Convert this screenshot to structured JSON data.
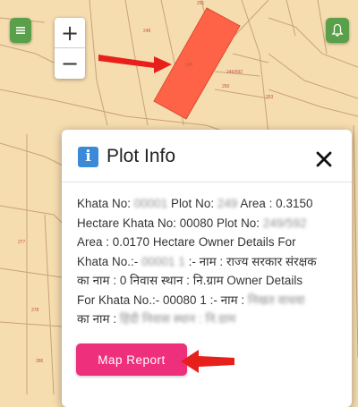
{
  "map": {
    "parcel_labels": [
      "248",
      "249",
      "249/592",
      "250",
      "251",
      "253",
      "277",
      "278",
      "286"
    ],
    "highlight_color": "#ff6347",
    "annotation_color": "#e8201c"
  },
  "controls": {
    "menu_icon": "menu-icon",
    "zoom_in": "+",
    "zoom_out": "−",
    "bell_icon": "bell-icon"
  },
  "panel": {
    "title": "Plot Info",
    "icon": "info-icon",
    "close": "close-icon",
    "lines": [
      [
        "Khata No: ",
        {
          "blur": "00001"
        },
        " Plot No: ",
        {
          "blur": "249"
        },
        " Area : 0.3150"
      ],
      [
        "Hectare Khata No: 00080 Plot No: ",
        {
          "blur": "249/592"
        }
      ],
      [
        "Area : 0.0170 Hectare Owner Details For"
      ],
      [
        "Khata No.:- ",
        {
          "blur": "00001 1"
        },
        " :- नाम : राज्य सरकार संरक्षक"
      ],
      [
        "का नाम : 0 निवास स्थान : नि.ग्राम Owner Details"
      ],
      [
        "For Khata No.:- 00080 1 :- नाम : ",
        {
          "blur": "निखत वाधवा"
        }
      ],
      [
        "का नाम : ",
        {
          "blur": "हिंदी निवास स्थान : नि.ग्राम"
        }
      ]
    ],
    "button_label": "Map Report"
  }
}
